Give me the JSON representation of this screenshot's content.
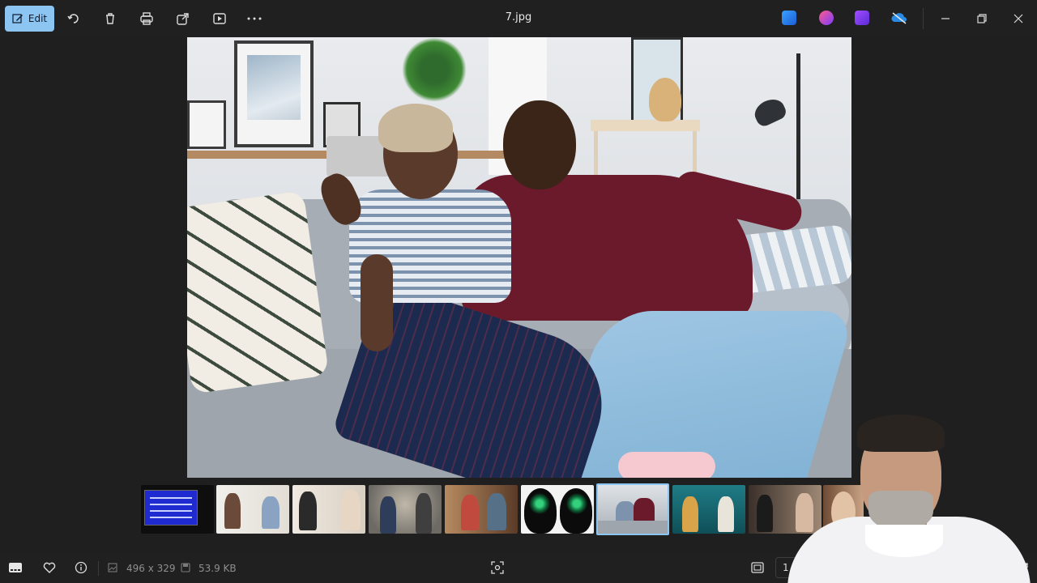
{
  "toolbar": {
    "edit_label": "Edit",
    "file_name": "7.jpg",
    "icons": [
      "edit-icon",
      "rotate-icon",
      "delete-icon",
      "print-icon",
      "share-icon",
      "slideshow-icon",
      "more-icon"
    ],
    "app_icons": [
      "photo-editor-app-icon",
      "copilot-app-icon",
      "clipchamp-app-icon",
      "onedrive-app-icon"
    ],
    "window_controls": [
      "minimize-icon",
      "restore-icon",
      "close-icon"
    ]
  },
  "photo": {
    "description_icon": "photo-of-couple-on-sofa"
  },
  "filmstrip": {
    "thumbnails": [
      {
        "name": "thumbnail-1",
        "selected": false
      },
      {
        "name": "thumbnail-2",
        "selected": false
      },
      {
        "name": "thumbnail-3",
        "selected": false
      },
      {
        "name": "thumbnail-4",
        "selected": false
      },
      {
        "name": "thumbnail-5",
        "selected": false
      },
      {
        "name": "thumbnail-6",
        "selected": false
      },
      {
        "name": "thumbnail-7",
        "selected": true
      },
      {
        "name": "thumbnail-8",
        "selected": false
      },
      {
        "name": "thumbnail-9",
        "selected": false
      },
      {
        "name": "thumbnail-10",
        "selected": false
      }
    ]
  },
  "status": {
    "dimensions": "496 x 329",
    "file_size": "53.9 KB",
    "zoom_partial": "1"
  },
  "colors": {
    "accent": "#8cc4f2",
    "background": "#1f1f1f",
    "toolbar": "#202020"
  }
}
